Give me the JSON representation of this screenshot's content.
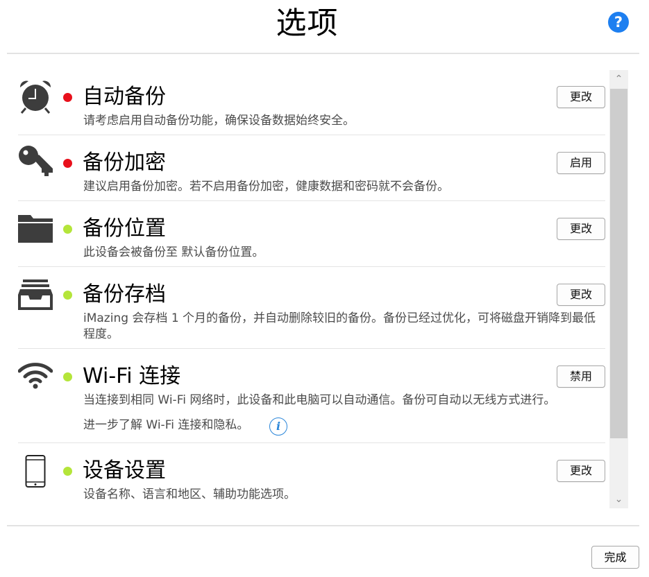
{
  "title": "选项",
  "help_label": "?",
  "colors": {
    "status_red": "#e8101b",
    "status_green": "#b4e53a",
    "help_blue": "#1d7ff0",
    "info_blue": "#2a86d9"
  },
  "options": [
    {
      "icon": "alarm-clock-icon",
      "status": "red",
      "title": "自动备份",
      "description": "请考虑启用自动备份功能，确保设备数据始终安全。",
      "button": "更改"
    },
    {
      "icon": "key-icon",
      "status": "red",
      "title": "备份加密",
      "description": "建议启用备份加密。若不启用备份加密，健康数据和密码就不会备份。",
      "button": "启用"
    },
    {
      "icon": "folder-icon",
      "status": "green",
      "title": "备份位置",
      "description": "此设备会被备份至 默认备份位置。",
      "button": "更改"
    },
    {
      "icon": "archive-tray-icon",
      "status": "green",
      "title": "备份存档",
      "description": "iMazing 会存档 1 个月的备份，并自动删除较旧的备份。备份已经过优化，可将磁盘开销降到最低程度。",
      "button": "更改"
    },
    {
      "icon": "wifi-icon",
      "status": "green",
      "title": "Wi-Fi 连接",
      "description": "当连接到相同 Wi-Fi 网络时，此设备和此电脑可以自动通信。备份可自动以无线方式进行。",
      "extra": "进一步了解 Wi-Fi 连接和隐私。",
      "info_label": "i",
      "button": "禁用"
    },
    {
      "icon": "smartphone-icon",
      "status": "green",
      "title": "设备设置",
      "description": "设备名称、语言和地区、辅助功能选项。",
      "button": "更改"
    }
  ],
  "done_label": "完成"
}
